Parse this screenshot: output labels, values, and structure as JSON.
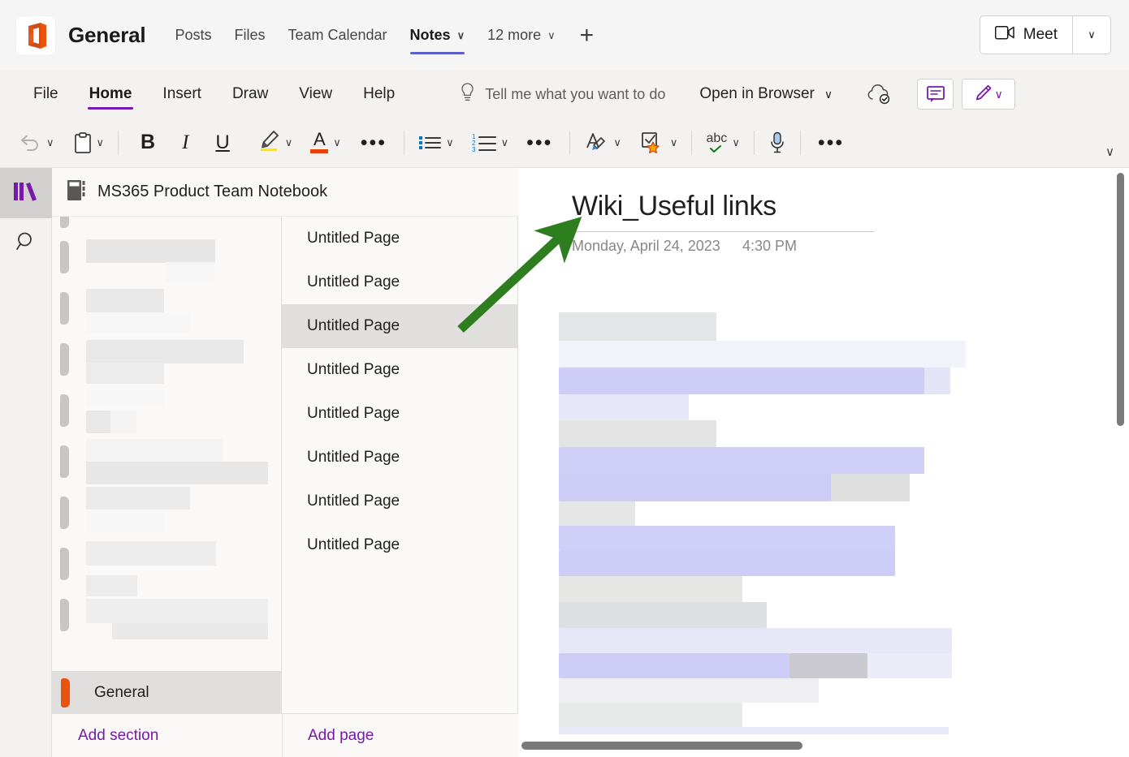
{
  "teams_bar": {
    "app_icon": "office-onenote-icon",
    "team_name": "General",
    "tabs": [
      {
        "label": "Posts",
        "has_chevron": false,
        "active": false
      },
      {
        "label": "Files",
        "has_chevron": false,
        "active": false
      },
      {
        "label": "Team Calendar",
        "has_chevron": false,
        "active": false
      },
      {
        "label": "Notes",
        "has_chevron": true,
        "active": true
      },
      {
        "label": "12 more",
        "has_chevron": true,
        "active": false
      }
    ],
    "add_tab_label": "+",
    "meet_label": "Meet",
    "meet_chevron": "∨"
  },
  "ribbon_menu": {
    "items": [
      {
        "label": "File",
        "active": false
      },
      {
        "label": "Home",
        "active": true
      },
      {
        "label": "Insert",
        "active": false
      },
      {
        "label": "Draw",
        "active": false
      },
      {
        "label": "View",
        "active": false
      },
      {
        "label": "Help",
        "active": false
      }
    ],
    "tell_me": "Tell me what you want to do",
    "open_in_browser": "Open in Browser",
    "accent_color": "#7719aa"
  },
  "toolbar": {
    "groups": [
      {
        "name": "undo",
        "items": [
          "undo-icon",
          "paste-icon"
        ]
      },
      {
        "name": "font",
        "items": [
          "bold-icon",
          "italic-icon",
          "underline-icon",
          "highlight-icon",
          "font-color-icon",
          "more-font-icon"
        ]
      },
      {
        "name": "lists",
        "items": [
          "bullet-list-icon",
          "numbered-list-icon",
          "more-paragraph-icon"
        ]
      },
      {
        "name": "styles",
        "items": [
          "styles-icon",
          "tags-icon",
          "spellcheck-icon",
          "dictate-icon",
          "more-icon"
        ]
      }
    ],
    "bold": "B",
    "italic": "I",
    "underline": "U",
    "font_letter": "A",
    "spellcheck_label": "abc",
    "list_numbers": [
      "1",
      "2",
      "3"
    ],
    "ellipsis": "•••",
    "chevron": "∨",
    "highlight_color": "#ffe500",
    "font_color": "#e8420a"
  },
  "left_rail": {
    "items": [
      {
        "name": "notebooks-icon",
        "selected": true
      },
      {
        "name": "search-icon",
        "selected": false
      }
    ]
  },
  "notebook": {
    "icon": "notebook-icon",
    "title": "MS365 Product Team Notebook"
  },
  "sections": {
    "redacted_rows": 9,
    "general": {
      "label": "General",
      "tab_color": "#e8530e",
      "selected": true
    },
    "add_section_label": "Add section"
  },
  "pages": {
    "items": [
      {
        "label": "Untitled Page",
        "selected": false
      },
      {
        "label": "Untitled Page",
        "selected": false
      },
      {
        "label": "Untitled Page",
        "selected": true
      },
      {
        "label": "Untitled Page",
        "selected": false
      },
      {
        "label": "Untitled Page",
        "selected": false
      },
      {
        "label": "Untitled Page",
        "selected": false
      },
      {
        "label": "Untitled Page",
        "selected": false
      },
      {
        "label": "Untitled Page",
        "selected": false
      }
    ],
    "add_page_label": "Add page"
  },
  "canvas": {
    "page_title": "Wiki_Useful links",
    "date": "Monday, April 24, 2023",
    "time": "4:30 PM",
    "body_state": "redacted"
  },
  "annotation": {
    "arrow_color": "#2e7d1e",
    "points_to": "page-title"
  },
  "scrollbars": {
    "vertical_thumb_color": "#7a7a7a",
    "horizontal_thumb_color": "#7a7a7a"
  }
}
